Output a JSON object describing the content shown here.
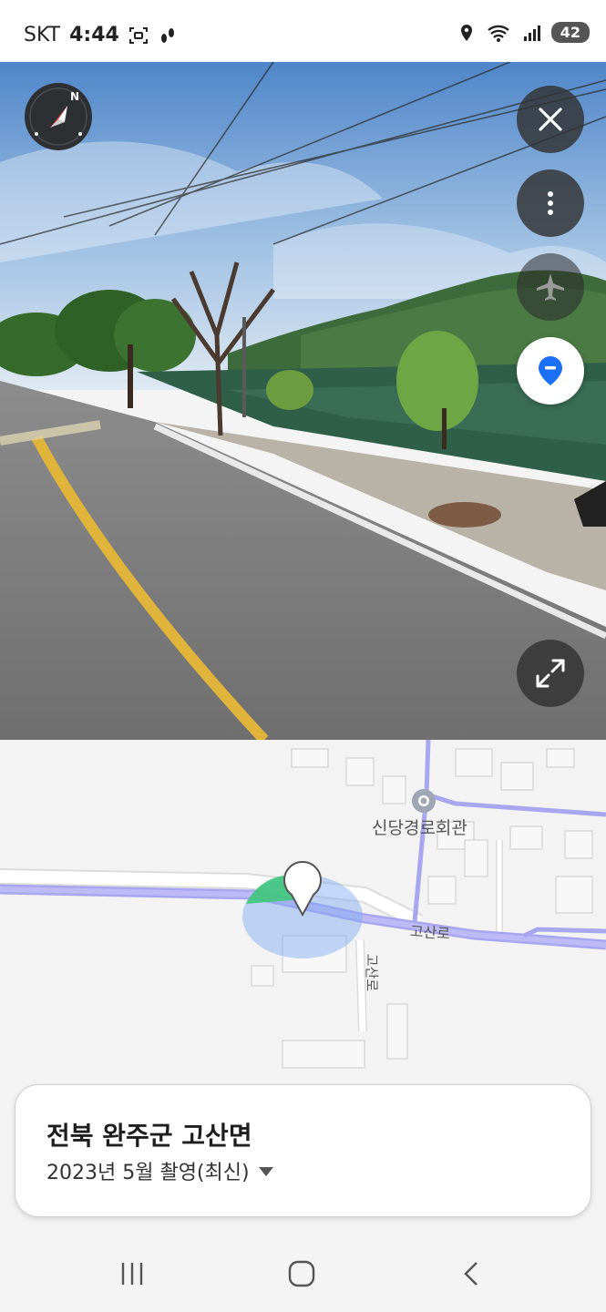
{
  "status_bar": {
    "carrier": "SKT",
    "time": "4:44",
    "battery": "42"
  },
  "panorama": {
    "compass_letter": "N",
    "buttons": {
      "close": "close-icon",
      "more": "more-vertical-icon",
      "aerial": "airplane-icon",
      "location": "location-pin-icon",
      "fullscreen": "expand-icon"
    }
  },
  "map": {
    "poi_label": "신당경로회관",
    "road_main_label": "고산로",
    "road_side_label": "고산로"
  },
  "location_card": {
    "title": "전북 완주군 고산면",
    "date": "2023년 5월 촬영(최신)"
  },
  "nav_bar": {
    "recent": "recent-apps-icon",
    "home": "home-icon",
    "back": "back-icon"
  },
  "colors": {
    "accent_blue": "#1b6ff5",
    "road_purple": "#a9a6f0",
    "view_cone_green": "#3ec77a",
    "radius_blue": "#7aa8f0"
  }
}
